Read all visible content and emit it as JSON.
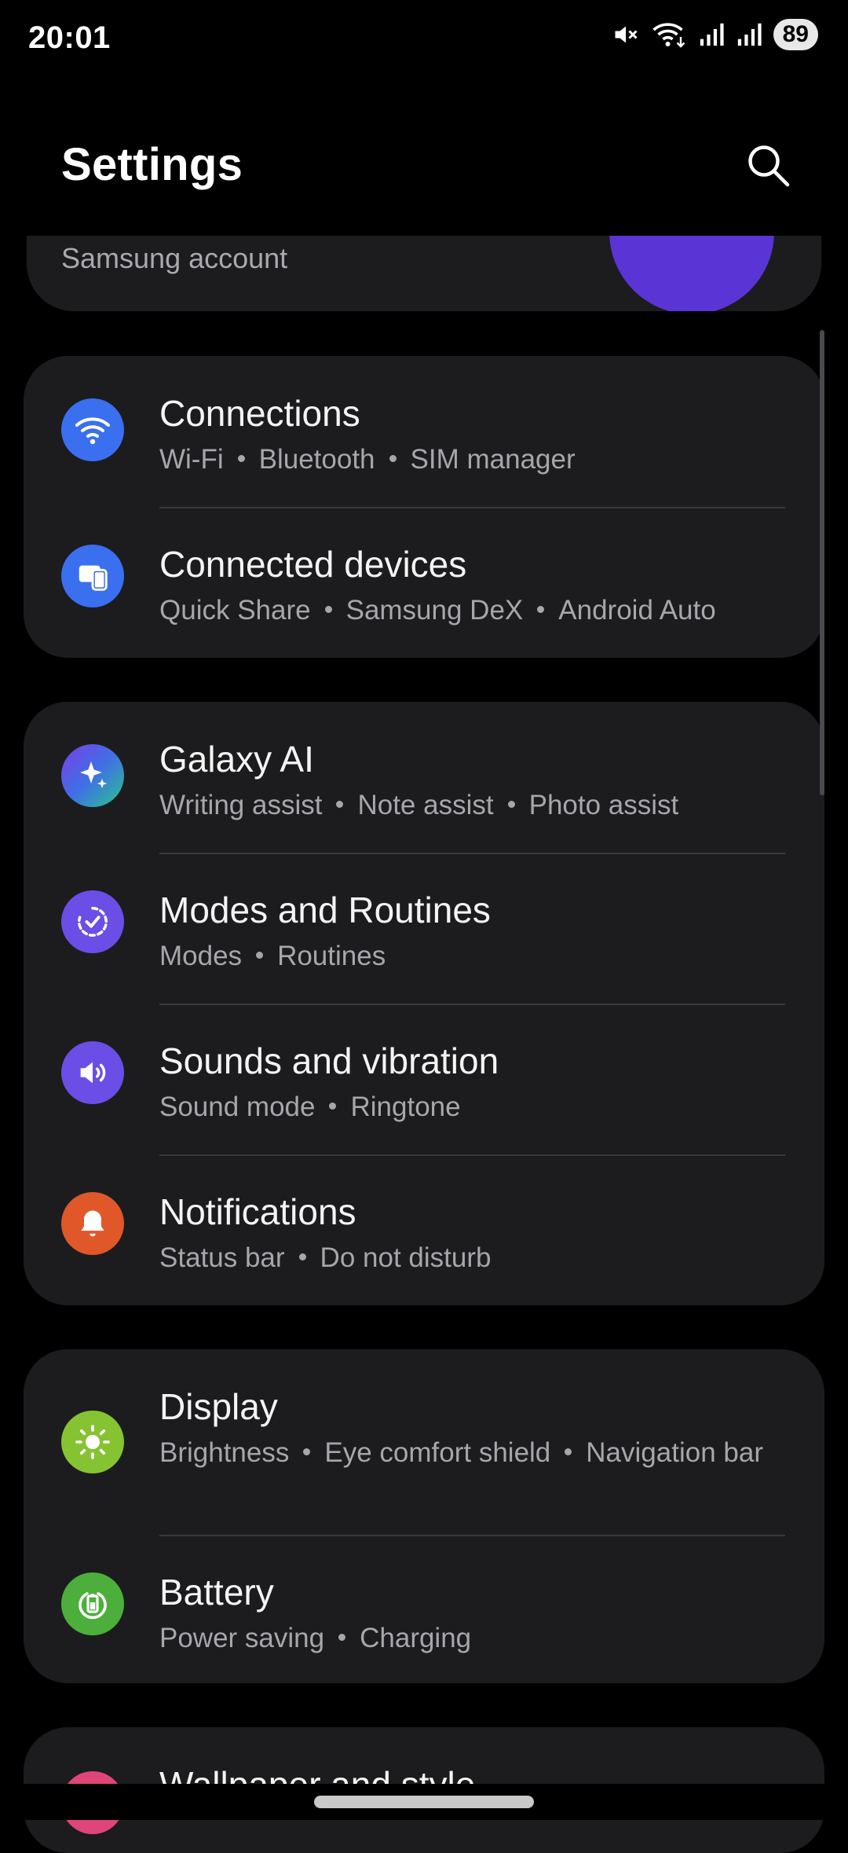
{
  "status_bar": {
    "time": "20:01",
    "battery": "89",
    "icons": [
      "mute-icon",
      "wifi-icon",
      "signal-1-icon",
      "signal-2-icon"
    ]
  },
  "header": {
    "title": "Settings",
    "search_icon": "search-icon"
  },
  "account": {
    "label": "Samsung account",
    "avatar_color": "#5b34d6"
  },
  "groups": [
    {
      "items": [
        {
          "title": "Connections",
          "subtitle": [
            "Wi-Fi",
            "Bluetooth",
            "SIM manager"
          ],
          "icon": "wifi-icon",
          "color": "#3a6ff0"
        },
        {
          "title": "Connected devices",
          "subtitle": [
            "Quick Share",
            "Samsung DeX",
            "Android Auto"
          ],
          "icon": "devices-icon",
          "color": "#3a6ff0"
        }
      ]
    },
    {
      "items": [
        {
          "title": "Galaxy AI",
          "subtitle": [
            "Writing assist",
            "Note assist",
            "Photo assist"
          ],
          "icon": "sparkle-icon",
          "color": "#3f6fe6"
        },
        {
          "title": "Modes and Routines",
          "subtitle": [
            "Modes",
            "Routines"
          ],
          "icon": "routine-check-icon",
          "color": "#6a4ee6"
        },
        {
          "title": "Sounds and vibration",
          "subtitle": [
            "Sound mode",
            "Ringtone"
          ],
          "icon": "speaker-icon",
          "color": "#6a4ee6"
        },
        {
          "title": "Notifications",
          "subtitle": [
            "Status bar",
            "Do not disturb"
          ],
          "icon": "bell-icon",
          "color": "#e0572a"
        }
      ]
    },
    {
      "items": [
        {
          "title": "Display",
          "subtitle": [
            "Brightness",
            "Eye comfort shield",
            "Navigation bar"
          ],
          "icon": "sun-icon",
          "color": "#86c332"
        },
        {
          "title": "Battery",
          "subtitle": [
            "Power saving",
            "Charging"
          ],
          "icon": "battery-icon",
          "color": "#4caf3c"
        }
      ]
    },
    {
      "items": [
        {
          "title": "Wallpaper and style",
          "subtitle": [],
          "icon": "wallpaper-icon",
          "color": "#e0457a"
        }
      ]
    }
  ]
}
